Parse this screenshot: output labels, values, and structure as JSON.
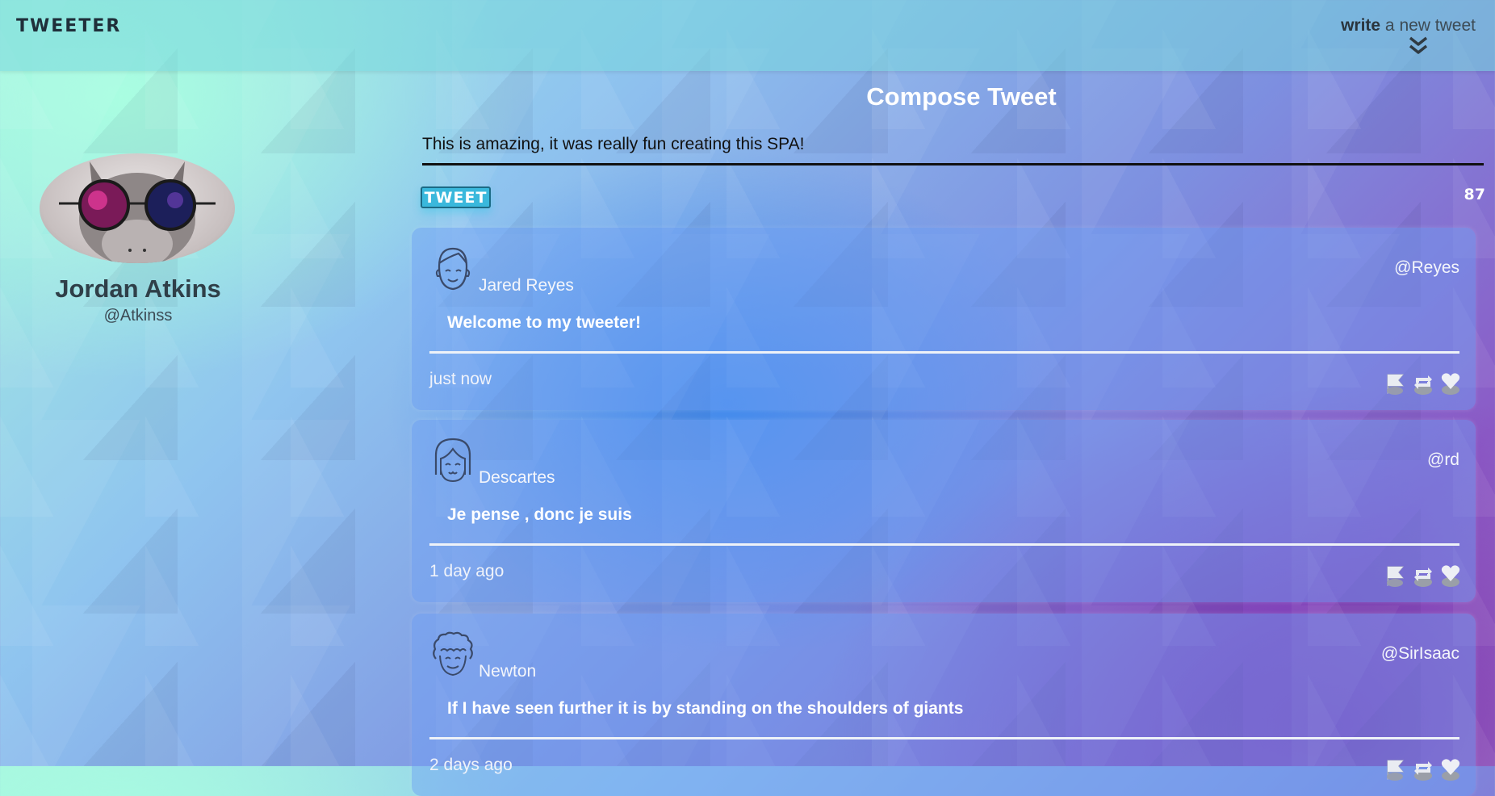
{
  "header": {
    "logo": "TWEETER",
    "write_bold": "write",
    "write_rest": " a new tweet",
    "toggle_icon": "double-chevron-down-icon"
  },
  "profile": {
    "name": "Jordan Atkins",
    "handle": "@Atkinss",
    "avatar_icon": "cat-with-galaxy-glasses"
  },
  "compose": {
    "title": "Compose Tweet",
    "text": "This is amazing, it was really fun creating this SPA!",
    "button_label": "TWEET",
    "char_count": "87"
  },
  "tweets": [
    {
      "author": "Jared Reyes",
      "handle": "@Reyes",
      "text": "Welcome to my tweeter!",
      "time": "just now",
      "avatar_icon": "smiling-face-line-icon"
    },
    {
      "author": "Descartes",
      "handle": "@rd",
      "text": "Je pense , donc je suis",
      "time": "1 day ago",
      "avatar_icon": "bob-hair-face-line-icon"
    },
    {
      "author": "Newton",
      "handle": "@SirIsaac",
      "text": "If I have seen further it is by standing on the shoulders of giants",
      "time": "2 days ago",
      "avatar_icon": "curly-hair-face-line-icon"
    }
  ],
  "action_icons": [
    "flag-icon",
    "retweet-icon",
    "heart-icon"
  ],
  "colors": {
    "tweet_button": "#3ab8dc",
    "card_overlay": "#6ea0f5"
  }
}
